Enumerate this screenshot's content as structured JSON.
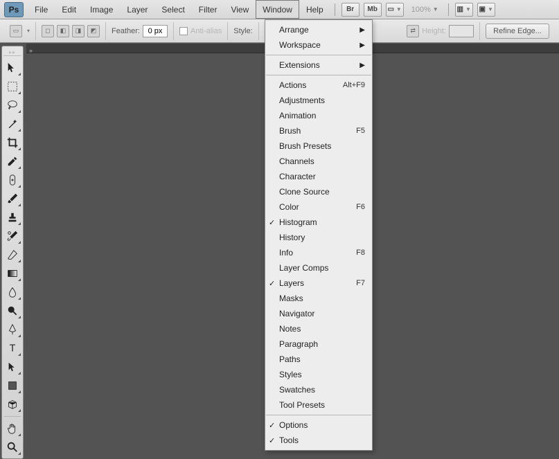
{
  "menubar": {
    "items": [
      "File",
      "Edit",
      "Image",
      "Layer",
      "Select",
      "Filter",
      "View",
      "Window",
      "Help"
    ],
    "activeIndex": 7,
    "br": "Br",
    "mb": "Mb",
    "zoom": "100%"
  },
  "options": {
    "feather_label": "Feather:",
    "feather_value": "0 px",
    "antialias_label": "Anti-alias",
    "style_label": "Style:",
    "height_label": "Height:",
    "refine": "Refine Edge..."
  },
  "window_menu": {
    "groups": [
      [
        {
          "label": "Arrange",
          "submenu": true
        },
        {
          "label": "Workspace",
          "submenu": true
        }
      ],
      [
        {
          "label": "Extensions",
          "submenu": true
        }
      ],
      [
        {
          "label": "Actions",
          "shortcut": "Alt+F9"
        },
        {
          "label": "Adjustments"
        },
        {
          "label": "Animation"
        },
        {
          "label": "Brush",
          "shortcut": "F5"
        },
        {
          "label": "Brush Presets"
        },
        {
          "label": "Channels"
        },
        {
          "label": "Character"
        },
        {
          "label": "Clone Source"
        },
        {
          "label": "Color",
          "shortcut": "F6"
        },
        {
          "label": "Histogram",
          "checked": true
        },
        {
          "label": "History"
        },
        {
          "label": "Info",
          "shortcut": "F8"
        },
        {
          "label": "Layer Comps"
        },
        {
          "label": "Layers",
          "checked": true,
          "shortcut": "F7"
        },
        {
          "label": "Masks"
        },
        {
          "label": "Navigator"
        },
        {
          "label": "Notes"
        },
        {
          "label": "Paragraph"
        },
        {
          "label": "Paths"
        },
        {
          "label": "Styles"
        },
        {
          "label": "Swatches"
        },
        {
          "label": "Tool Presets"
        }
      ],
      [
        {
          "label": "Options",
          "checked": true
        },
        {
          "label": "Tools",
          "checked": true
        }
      ]
    ]
  },
  "tools": [
    "move",
    "marquee",
    "lasso",
    "wand",
    "crop",
    "eyedropper",
    "healing",
    "brush",
    "stamp",
    "history-brush",
    "eraser",
    "gradient",
    "blur",
    "dodge",
    "pen",
    "type",
    "path-select",
    "shape",
    "3d",
    "hand",
    "zoom"
  ]
}
